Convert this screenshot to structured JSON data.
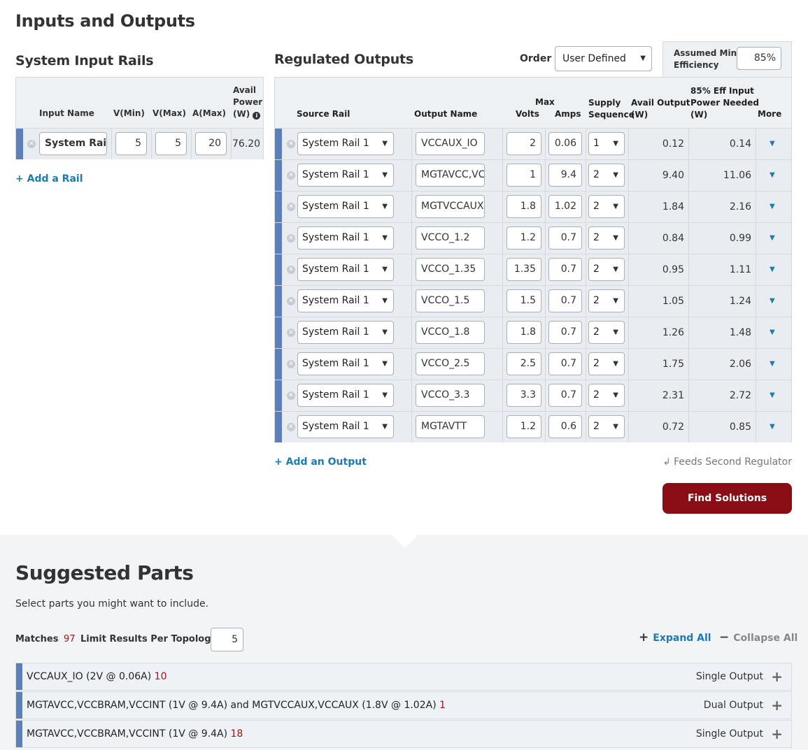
{
  "page_title": "Inputs and Outputs",
  "input_rails": {
    "title": "System Input Rails",
    "headers": {
      "name": "Input Name",
      "vmin": "V(Min)",
      "vmax": "V(Max)",
      "amax": "A(Max)",
      "power_l1": "Avail",
      "power_l2": "Power",
      "power_l3": "(W)"
    },
    "rows": [
      {
        "name": "System Rail",
        "vmin": "5",
        "vmax": "5",
        "amax": "20",
        "power": "76.20"
      }
    ],
    "add_link": "+ Add a Rail"
  },
  "outputs": {
    "title": "Regulated Outputs",
    "order_label": "Order",
    "order_value": "User Defined",
    "efficiency_label_l1": "Assumed Min",
    "efficiency_label_l2": "Efficiency",
    "efficiency_value": "85%",
    "headers": {
      "source": "Source Rail",
      "name": "Output Name",
      "max": "Max",
      "volts": "Volts",
      "amps": "Amps",
      "supply": "Supply",
      "sequence": "Sequence",
      "avail_l1": "Avail Output",
      "avail_l2": "(W)",
      "eff_l1": "85% Eff Input",
      "eff_l2": "Power Needed",
      "eff_l3": "(W)",
      "more": "More"
    },
    "rows": [
      {
        "source": "System Rail 1",
        "name": "VCCAUX_IO",
        "volts": "2",
        "amps": "0.06",
        "seq": "1",
        "avail": "0.12",
        "needed": "0.14"
      },
      {
        "source": "System Rail 1",
        "name": "MGTAVCC,VCCBRAM,VCCINT",
        "volts": "1",
        "amps": "9.4",
        "seq": "2",
        "avail": "9.40",
        "needed": "11.06"
      },
      {
        "source": "System Rail 1",
        "name": "MGTVCCAUX,VCCAUX",
        "volts": "1.8",
        "amps": "1.02",
        "seq": "2",
        "avail": "1.84",
        "needed": "2.16"
      },
      {
        "source": "System Rail 1",
        "name": "VCCO_1.2",
        "volts": "1.2",
        "amps": "0.7",
        "seq": "2",
        "avail": "0.84",
        "needed": "0.99"
      },
      {
        "source": "System Rail 1",
        "name": "VCCO_1.35",
        "volts": "1.35",
        "amps": "0.7",
        "seq": "2",
        "avail": "0.95",
        "needed": "1.11"
      },
      {
        "source": "System Rail 1",
        "name": "VCCO_1.5",
        "volts": "1.5",
        "amps": "0.7",
        "seq": "2",
        "avail": "1.05",
        "needed": "1.24"
      },
      {
        "source": "System Rail 1",
        "name": "VCCO_1.8",
        "volts": "1.8",
        "amps": "0.7",
        "seq": "2",
        "avail": "1.26",
        "needed": "1.48"
      },
      {
        "source": "System Rail 1",
        "name": "VCCO_2.5",
        "volts": "2.5",
        "amps": "0.7",
        "seq": "2",
        "avail": "1.75",
        "needed": "2.06"
      },
      {
        "source": "System Rail 1",
        "name": "VCCO_3.3",
        "volts": "3.3",
        "amps": "0.7",
        "seq": "2",
        "avail": "2.31",
        "needed": "2.72"
      },
      {
        "source": "System Rail 1",
        "name": "MGTAVTT",
        "volts": "1.2",
        "amps": "0.6",
        "seq": "2",
        "avail": "0.72",
        "needed": "0.85"
      }
    ],
    "add_link": "+ Add an Output",
    "feeds_label": "Feeds Second Regulator",
    "find_button": "Find Solutions"
  },
  "suggested": {
    "title": "Suggested Parts",
    "subtitle": "Select parts you might want to include.",
    "matches_label": "Matches",
    "matches_count": "97",
    "limit_label": "Limit Results Per Topology",
    "limit_value": "5",
    "expand_all": "Expand All",
    "collapse_all": "Collapse All",
    "rows": [
      {
        "label": "VCCAUX_IO (2V @ 0.06A)",
        "count": "10",
        "type": "Single Output"
      },
      {
        "label": "MGTAVCC,VCCBRAM,VCCINT (1V @ 9.4A) and MGTVCCAUX,VCCAUX (1.8V @ 1.02A)",
        "count": "1",
        "type": "Dual Output"
      },
      {
        "label": "MGTAVCC,VCCBRAM,VCCINT (1V @ 9.4A)",
        "count": "18",
        "type": "Single Output"
      }
    ]
  },
  "colors": {
    "accent_blue": "#1e7ab5",
    "rail_bar": "#5b7fb8",
    "find_button": "#8a0c14",
    "count_red": "#a0141c"
  }
}
